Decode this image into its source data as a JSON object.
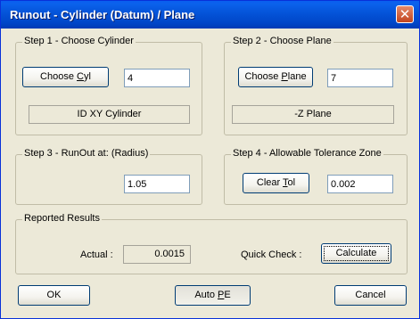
{
  "window": {
    "title": "Runout - Cylinder (Datum) / Plane",
    "close_glyph": "✕"
  },
  "step1": {
    "legend": "Step 1 - Choose Cylinder",
    "button_pre": "Choose ",
    "button_accel": "C",
    "button_post": "yl",
    "value": "4",
    "display": "ID XY Cylinder"
  },
  "step2": {
    "legend": "Step 2 - Choose Plane",
    "button_pre": "Choose ",
    "button_accel": "P",
    "button_post": "lane",
    "value": "7",
    "display": "-Z Plane"
  },
  "step3": {
    "legend": "Step 3 - RunOut at: (Radius)",
    "value": "1.05"
  },
  "step4": {
    "legend": "Step 4 - Allowable Tolerance Zone",
    "button_pre": "Clear ",
    "button_accel": "T",
    "button_post": "ol",
    "value": "0.002"
  },
  "results": {
    "legend": "Reported Results",
    "actual_label": "Actual :",
    "actual_value": "0.0015",
    "quick_check_label": "Quick Check :",
    "calculate_label": "Calculate"
  },
  "footer": {
    "ok_label": "OK",
    "auto_pe_pre": "Auto ",
    "auto_pe_accel": "P",
    "auto_pe_post": "E",
    "cancel_label": "Cancel"
  }
}
